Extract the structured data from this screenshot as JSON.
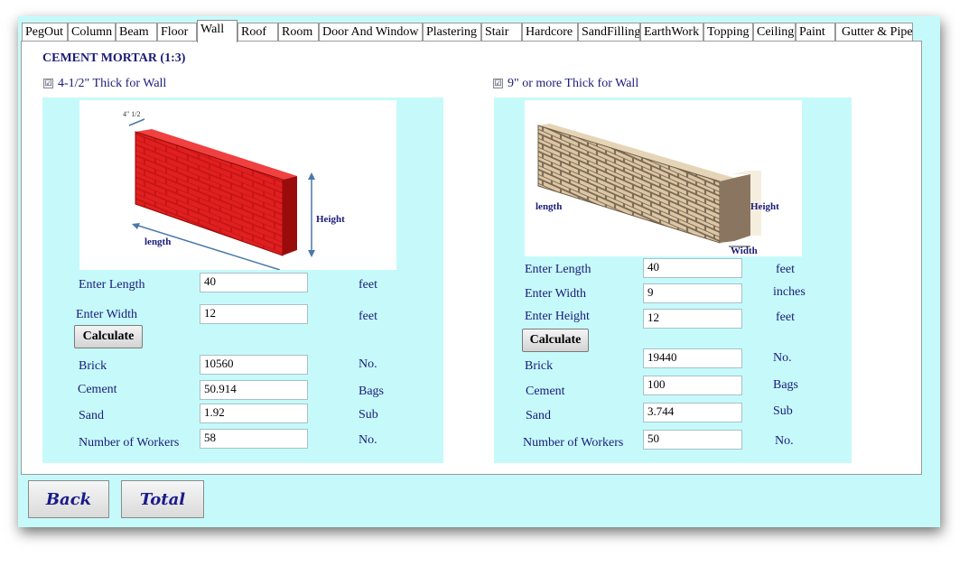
{
  "tabs": [
    "PegOut",
    "Column",
    "Beam",
    "Floor",
    "Wall",
    "Roof",
    "Room",
    "Door And Window",
    "Plastering",
    "Stair",
    "Hardcore",
    "SandFilling",
    "EarthWork",
    "Topping",
    "Ceiling",
    "Paint",
    "Gutter & Pipe"
  ],
  "active_tab": "Wall",
  "heading": "CEMENT MORTAR (1:3)",
  "left": {
    "checkbox_label": "4-1/2\" Thick for Wall",
    "checked_mark": "☑",
    "image_labels": {
      "thickness": "4\" 1/2",
      "height": "Height",
      "length": "length"
    },
    "inputs": [
      {
        "label": "Enter Length",
        "value": "40",
        "unit": "feet"
      },
      {
        "label": "Enter Width",
        "value": "12",
        "unit": "feet"
      }
    ],
    "calculate_label": "Calculate",
    "results": [
      {
        "label": "Brick",
        "value": "10560",
        "unit": "No."
      },
      {
        "label": "Cement",
        "value": "50.914",
        "unit": "Bags"
      },
      {
        "label": "Sand",
        "value": "1.92",
        "unit": "Sub"
      },
      {
        "label": "Number of Workers",
        "value": "58",
        "unit": "No."
      }
    ]
  },
  "right": {
    "checkbox_label": "9\" or more Thick for Wall",
    "checked_mark": "☑",
    "image_labels": {
      "length": "length",
      "height": "Height",
      "width": "Width"
    },
    "inputs": [
      {
        "label": "Enter Length",
        "value": "40",
        "unit": "feet"
      },
      {
        "label": "Enter Width",
        "value": "9",
        "unit": "inches"
      },
      {
        "label": "Enter Height",
        "value": "12",
        "unit": "feet"
      }
    ],
    "calculate_label": "Calculate",
    "results": [
      {
        "label": "Brick",
        "value": "19440",
        "unit": "No."
      },
      {
        "label": "Cement",
        "value": "100",
        "unit": "Bags"
      },
      {
        "label": "Sand",
        "value": "3.744",
        "unit": "Sub"
      },
      {
        "label": "Number of Workers",
        "value": "50",
        "unit": "No."
      }
    ]
  },
  "buttons": {
    "back": "Back",
    "total": "Total"
  },
  "colors": {
    "background": "#c6fafa",
    "label_text": "#1a1a7a",
    "brick_red": "#d41a1a",
    "brick_tan": "#d9c2a0"
  }
}
